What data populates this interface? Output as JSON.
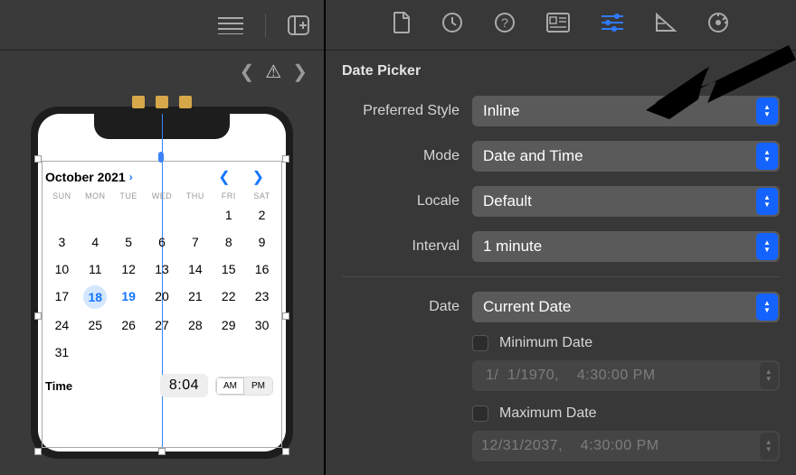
{
  "left": {
    "breadcrumb_warning": "⚠",
    "phone_icons": 3
  },
  "inspector": {
    "section_title": "Date Picker",
    "rows": {
      "preferred_style": {
        "label": "Preferred Style",
        "value": "Inline"
      },
      "mode": {
        "label": "Mode",
        "value": "Date and Time"
      },
      "locale": {
        "label": "Locale",
        "value": "Default"
      },
      "interval": {
        "label": "Interval",
        "value": "1 minute"
      },
      "date": {
        "label": "Date",
        "value": "Current Date"
      }
    },
    "min_date": {
      "label": "Minimum Date",
      "value": " 1/  1/1970,    4:30:00 PM"
    },
    "max_date": {
      "label": "Maximum Date",
      "value": "12/31/2037,    4:30:00 PM"
    }
  },
  "calendar": {
    "title": "October 2021",
    "dow": [
      "SUN",
      "MON",
      "TUE",
      "WED",
      "THU",
      "FRI",
      "SAT"
    ],
    "weeks": [
      [
        "",
        "",
        "",
        "",
        "",
        "1",
        "2"
      ],
      [
        "3",
        "4",
        "5",
        "6",
        "7",
        "8",
        "9"
      ],
      [
        "10",
        "11",
        "12",
        "13",
        "14",
        "15",
        "16"
      ],
      [
        "17",
        "18",
        "19",
        "20",
        "21",
        "22",
        "23"
      ],
      [
        "24",
        "25",
        "26",
        "27",
        "28",
        "29",
        "30"
      ],
      [
        "31",
        "",
        "",
        "",
        "",
        "",
        ""
      ]
    ],
    "selected": "18",
    "today": "19",
    "time_label": "Time",
    "time_value": "8:04",
    "am": "AM",
    "pm": "PM"
  }
}
